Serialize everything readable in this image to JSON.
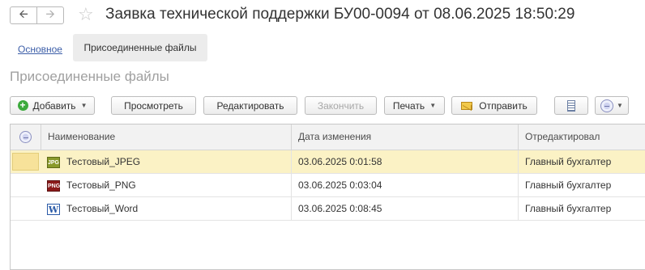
{
  "header": {
    "back_icon": "arrow-left-icon",
    "forward_icon": "arrow-right-icon",
    "favorite_icon": "star-icon",
    "title": "Заявка технической поддержки БУ00-0094 от 08.06.2025 18:50:29"
  },
  "tabs": [
    {
      "label": "Основное",
      "active": false
    },
    {
      "label": "Присоединенные файлы",
      "active": true
    }
  ],
  "section_title": "Присоединенные файлы",
  "toolbar": {
    "add_label": "Добавить",
    "view_label": "Просмотреть",
    "edit_label": "Редактировать",
    "finish_label": "Закончить",
    "print_label": "Печать",
    "send_label": "Отправить"
  },
  "table": {
    "columns": [
      "Наименование",
      "Дата изменения",
      "Отредактировал"
    ],
    "rows": [
      {
        "icon": "jpeg-file-icon",
        "icon_text": "JPG",
        "name": "Тестовый_JPEG",
        "date": "03.06.2025 0:01:58",
        "editor": "Главный бухгалтер",
        "selected": true
      },
      {
        "icon": "png-file-icon",
        "icon_text": "PNG",
        "name": "Тестовый_PNG",
        "date": "03.06.2025 0:03:04",
        "editor": "Главный бухгалтер",
        "selected": false
      },
      {
        "icon": "word-file-icon",
        "icon_text": "W",
        "name": "Тестовый_Word",
        "date": "03.06.2025 0:08:45",
        "editor": "Главный бухгалтер",
        "selected": false
      }
    ]
  },
  "colors": {
    "selected_row": "#fbf2c5",
    "link": "#3c5ea8",
    "add_icon": "#3caa3c"
  }
}
